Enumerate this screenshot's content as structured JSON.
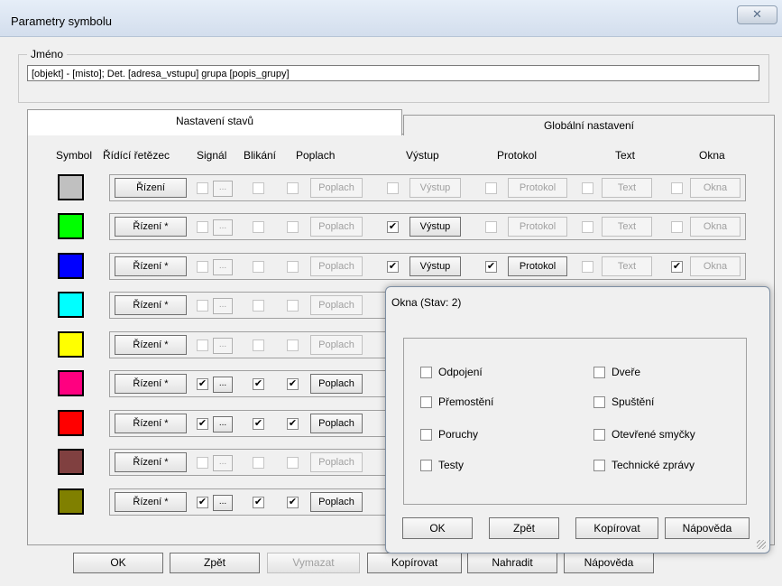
{
  "window": {
    "title": "Parametry symbolu",
    "close_label": "✕"
  },
  "name_group": {
    "legend": "Jméno",
    "value": "[objekt] - [misto]; Det. [adresa_vstupu] grupa [popis_grupy]"
  },
  "tabs": [
    {
      "label": "Nastavení stavů"
    },
    {
      "label": "Globální nastavení"
    }
  ],
  "columns": {
    "symbol": "Symbol",
    "chain": "Řídící řetězec",
    "signal": "Signál",
    "blink": "Blikání",
    "alarm": "Poplach",
    "output": "Výstup",
    "protocol": "Protokol",
    "text": "Text",
    "windows": "Okna"
  },
  "rows": [
    {
      "color": "#c0c0c0",
      "ctrl": "Řízení",
      "signal": false,
      "dots_enabled": false,
      "blink": false,
      "alarm": false,
      "alarm_btn": "Poplach",
      "alarm_enabled": false,
      "output": false,
      "output_btn": "Výstup",
      "output_enabled": false,
      "protocol": false,
      "protocol_btn": "Protokol",
      "protocol_enabled": false,
      "text": false,
      "text_btn": "Text",
      "windows": false,
      "windows_btn": "Okna"
    },
    {
      "color": "#00ff00",
      "ctrl": "Řízení *",
      "signal": false,
      "dots_enabled": false,
      "blink": false,
      "alarm": false,
      "alarm_btn": "Poplach",
      "alarm_enabled": false,
      "output": true,
      "output_btn": "Výstup",
      "output_enabled": true,
      "protocol": false,
      "protocol_btn": "Protokol",
      "protocol_enabled": false,
      "text": false,
      "text_btn": "Text",
      "windows": false,
      "windows_btn": "Okna"
    },
    {
      "color": "#0000ff",
      "ctrl": "Řízení *",
      "signal": false,
      "dots_enabled": false,
      "blink": false,
      "alarm": false,
      "alarm_btn": "Poplach",
      "alarm_enabled": false,
      "output": true,
      "output_btn": "Výstup",
      "output_enabled": true,
      "protocol": true,
      "protocol_btn": "Protokol",
      "protocol_enabled": true,
      "text": false,
      "text_btn": "Text",
      "windows": true,
      "windows_btn": "Okna"
    },
    {
      "color": "#00ffff",
      "ctrl": "Řízení *",
      "signal": false,
      "dots_enabled": false,
      "blink": false,
      "alarm": false,
      "alarm_btn": "Poplach",
      "alarm_enabled": false
    },
    {
      "color": "#ffff00",
      "ctrl": "Řízení *",
      "signal": false,
      "dots_enabled": false,
      "blink": false,
      "alarm": false,
      "alarm_btn": "Poplach",
      "alarm_enabled": false
    },
    {
      "color": "#ff0080",
      "ctrl": "Řízení *",
      "signal": true,
      "dots_enabled": true,
      "blink": true,
      "alarm": true,
      "alarm_btn": "Poplach",
      "alarm_enabled": true
    },
    {
      "color": "#ff0000",
      "ctrl": "Řízení *",
      "signal": true,
      "dots_enabled": true,
      "blink": true,
      "alarm": true,
      "alarm_btn": "Poplach",
      "alarm_enabled": true
    },
    {
      "color": "#804040",
      "ctrl": "Řízení *",
      "signal": false,
      "dots_enabled": false,
      "blink": false,
      "alarm": false,
      "alarm_btn": "Poplach",
      "alarm_enabled": false
    },
    {
      "color": "#808000",
      "ctrl": "Řízení *",
      "signal": true,
      "dots_enabled": true,
      "blink": true,
      "alarm": true,
      "alarm_btn": "Poplach",
      "alarm_enabled": true
    }
  ],
  "dots_label": "...",
  "check_mark": "✔",
  "bottom_buttons": {
    "ok": "OK",
    "back": "Zpět",
    "clear": "Vymazat",
    "copy": "Kopírovat",
    "replace": "Nahradit",
    "help": "Nápověda"
  },
  "popup": {
    "title": "Okna (Stav: 2)",
    "options_left": [
      "Odpojení",
      "Přemostění",
      "Poruchy",
      "Testy"
    ],
    "options_right": [
      "Dveře",
      "Spuštění",
      "Otevřené smyčky",
      "Technické zprávy"
    ],
    "buttons": {
      "ok": "OK",
      "back": "Zpět",
      "copy": "Kopírovat",
      "help": "Nápověda"
    }
  }
}
